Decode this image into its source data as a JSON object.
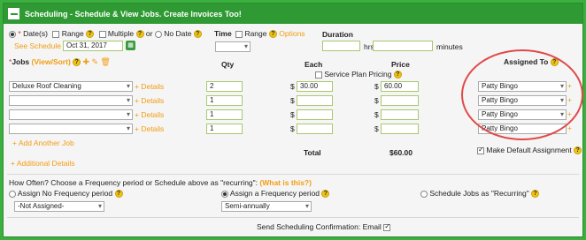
{
  "header": {
    "title": "Scheduling - Schedule & View Jobs. Create Invoices Too!"
  },
  "date_row": {
    "date_label": "Date(s)",
    "range_label": "Range",
    "multiple_label": "Multiple",
    "or_label": "or",
    "no_date_label": "No Date",
    "see_schedule": "See Schedule",
    "date_value": "Oct 31, 2017"
  },
  "time_row": {
    "time_label": "Time",
    "range_label": "Range",
    "options_label": "Options",
    "time_select": ""
  },
  "duration": {
    "label": "Duration",
    "hrs_label": "hrs",
    "minutes_label": "minutes",
    "hrs_value": "",
    "minutes_value": ""
  },
  "columns": {
    "jobs": "Jobs",
    "view_sort": "(View/Sort)",
    "qty": "Qty",
    "each": "Each",
    "price": "Price",
    "assigned_to": "Assigned To",
    "service_plan_pricing": "Service Plan Pricing"
  },
  "jobs": [
    {
      "name": "Deluxe Roof Cleaning",
      "details": "+ Details",
      "qty": "2",
      "each": "30.00",
      "price": "60.00",
      "assigned": "Patty Bingo"
    },
    {
      "name": "",
      "details": "+ Details",
      "qty": "1",
      "each": "",
      "price": "",
      "assigned": "Patty Bingo"
    },
    {
      "name": "",
      "details": "+ Details",
      "qty": "1",
      "each": "",
      "price": "",
      "assigned": "Patty Bingo"
    },
    {
      "name": "",
      "details": "+ Details",
      "qty": "1",
      "each": "",
      "price": "",
      "assigned": "Patty Bingo"
    }
  ],
  "currency": "$",
  "add_job": "+ Add Another Job",
  "total": {
    "label": "Total",
    "value": "$60.00"
  },
  "make_default": "Make Default Assignment",
  "additional_details": "+ Additional Details",
  "frequency": {
    "question": "How Often? Choose a Frequency period or Schedule above as \"recurring\":",
    "what_is_this": "(What is this?)",
    "option_none": "Assign No Frequency period",
    "option_assign": "Assign a Frequency period",
    "option_recurring": "Schedule Jobs as \"Recurring\"",
    "not_assigned": "-Not Assigned-",
    "period": "Semi-annually"
  },
  "confirmation": {
    "label": "Send Scheduling Confirmation:",
    "email_label": "Email"
  },
  "colors": {
    "green": "#2f9a33",
    "orange": "#f39c12",
    "highlight_circle": "#e04a4a"
  }
}
